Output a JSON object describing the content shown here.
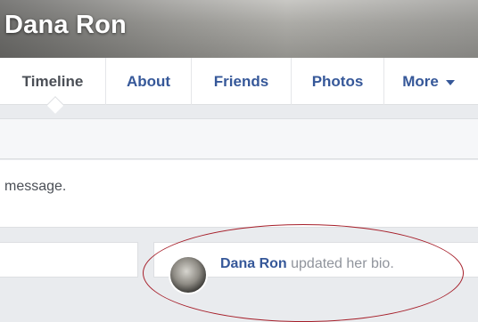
{
  "profile": {
    "name": "Dana Ron"
  },
  "tabs": [
    {
      "label": "Timeline",
      "active": true
    },
    {
      "label": "About"
    },
    {
      "label": "Friends"
    },
    {
      "label": "Photos"
    },
    {
      "label": "More"
    }
  ],
  "message": {
    "text": "message."
  },
  "feed": {
    "author": "Dana Ron",
    "action": " updated her bio."
  },
  "colors": {
    "link": "#365899",
    "highlight": "#a61f2a",
    "background": "#e9ebee"
  }
}
